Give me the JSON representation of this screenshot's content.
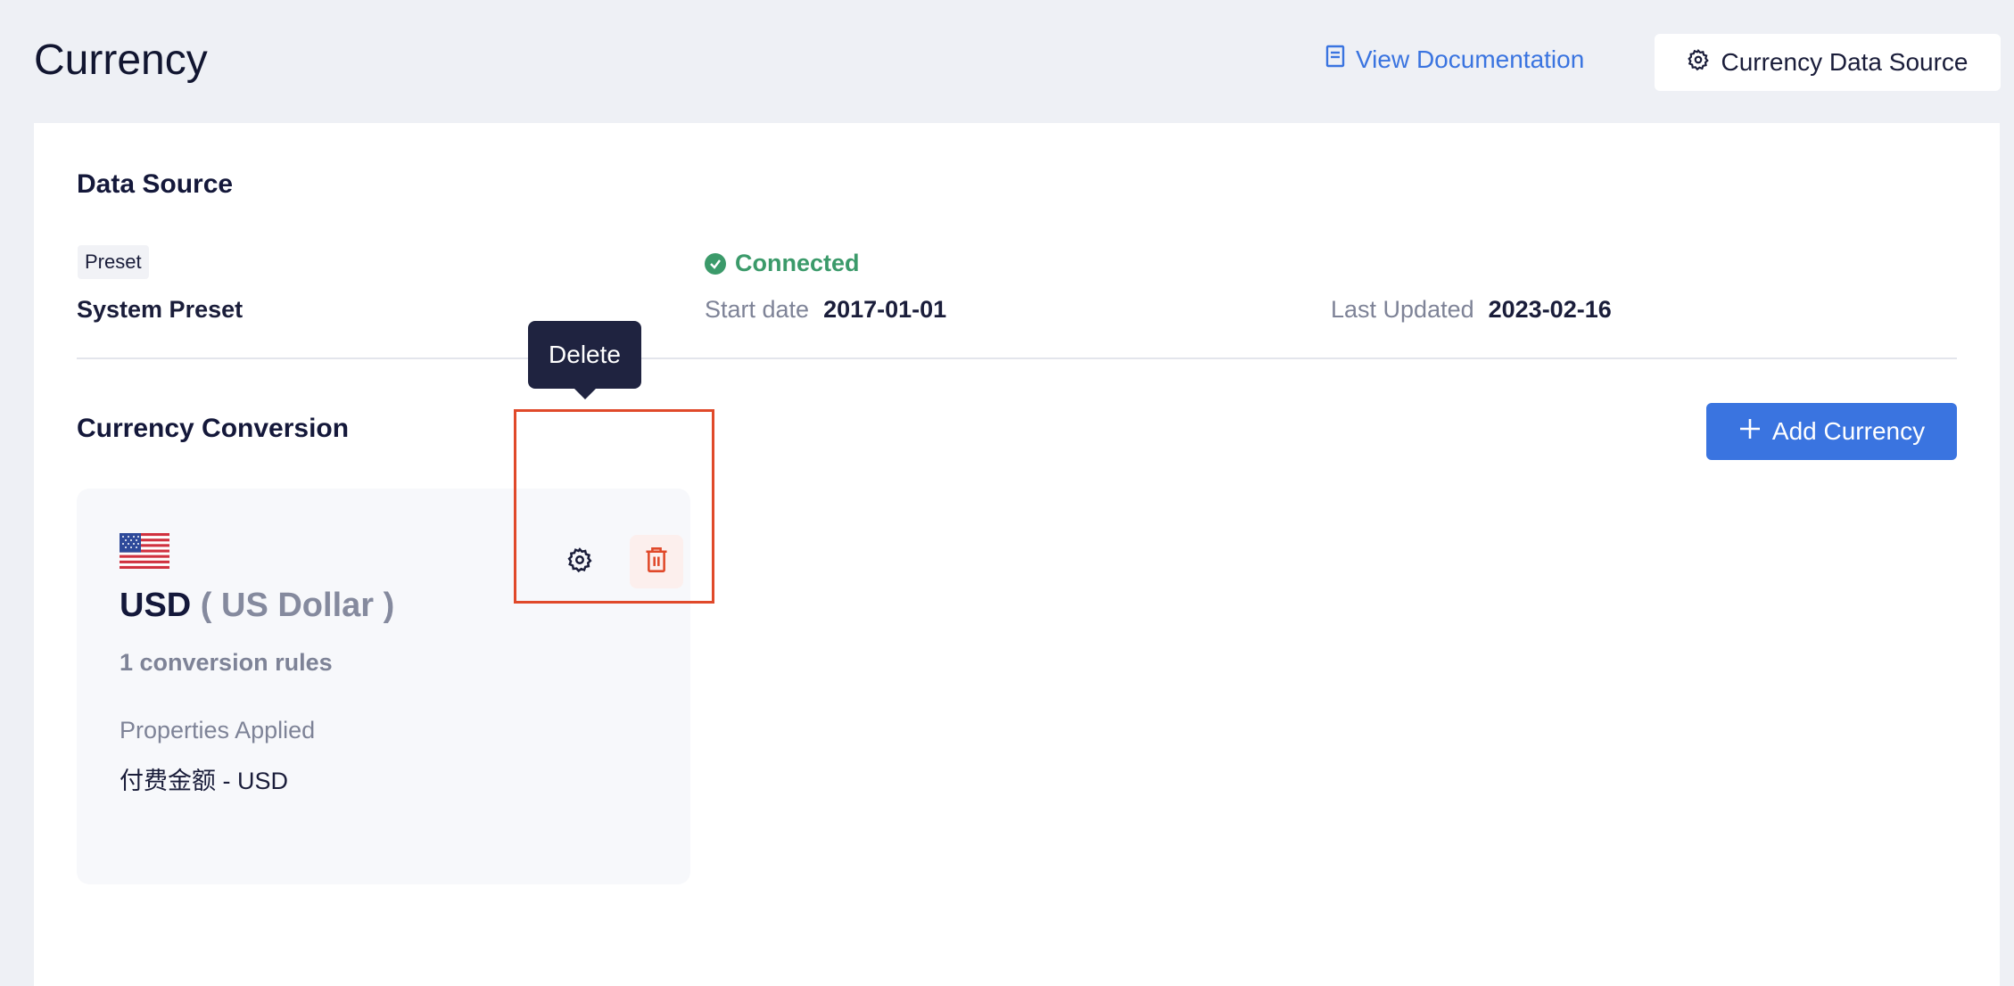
{
  "header": {
    "title": "Currency",
    "doc_link": "View Documentation",
    "data_source_button": "Currency Data Source"
  },
  "data_source": {
    "section_title": "Data Source",
    "tag": "Preset",
    "name": "System Preset",
    "status": "Connected",
    "start_date_label": "Start date",
    "start_date": "2017-01-01",
    "last_updated_label": "Last Updated",
    "last_updated": "2023-02-16"
  },
  "conversion": {
    "section_title": "Currency Conversion",
    "add_button": "Add Currency",
    "cards": [
      {
        "flag": "🇺🇸",
        "code": "USD",
        "name": "( US Dollar )",
        "rules": "1 conversion rules",
        "properties_label": "Properties Applied",
        "properties_value": "付费金额 - USD"
      }
    ]
  },
  "tooltip": {
    "label": "Delete"
  },
  "colors": {
    "accent": "#3a74e0",
    "success": "#3b9a6a",
    "danger": "#e0492a",
    "highlight_box": "#e0492a"
  },
  "icons": {
    "doc": "document-icon",
    "data_source": "gear-icon",
    "status": "check-circle-icon",
    "add": "plus-icon",
    "settings": "gear-icon",
    "delete": "trash-icon"
  }
}
